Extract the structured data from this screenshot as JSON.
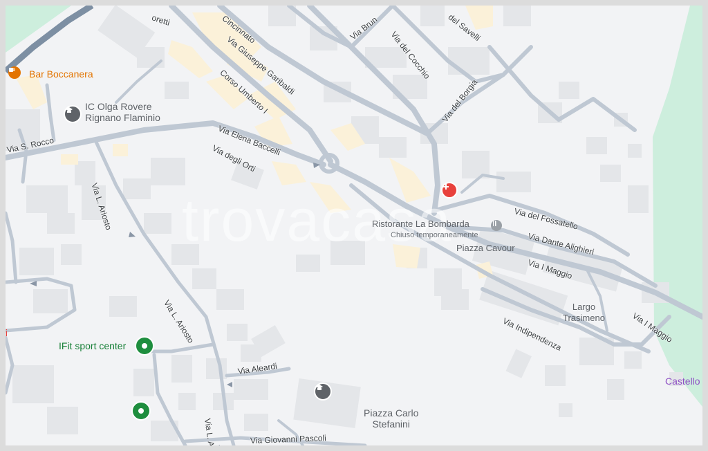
{
  "watermark": "trovacasa",
  "colors": {
    "background": "#f2f3f5",
    "road": "#bfc8d3",
    "building": "#e4e6e9",
    "highlight": "#fbf1d9",
    "park": "#cdeedd",
    "medical": "#e8413c",
    "green_pin": "#1e8e3e",
    "orange": "#e37400",
    "purple": "#8e4fc4"
  },
  "streets": {
    "ioretti": "oretti",
    "cincinnato": "Cincinnato",
    "giuseppe_garibaldi": "Via Giuseppe Garibaldi",
    "via_bruno": "Via Brun",
    "savelli": "del Savelli",
    "via_del_cocchio": "Via del Cocchio",
    "via_del_borgia": "Via del Borgia",
    "corso_umberto": "Corso Umberto I",
    "via_elena_baccelli": "Via Elena Baccelli",
    "via_degli_orti": "Via degli Orti",
    "via_s_rocco": "Via S. Rocco",
    "via_l_ariosto_1": "Via L. Ariosto",
    "via_l_ariosto_2": "Via L. Ariosto",
    "via_l_ario_3": "Via L. Ario",
    "via_del_fossatello": "Via del Fossatello",
    "via_dante_alighieri": "Via Dante Alighieri",
    "via_i_maggio_1": "Via I Maggio",
    "via_i_maggio_2": "Via I Maggio",
    "via_indipendenza": "Via Indipendenza",
    "via_aleardi": "Via Aleardi",
    "via_giovanni_pascoli": "Via Giovanni Pascoli"
  },
  "places": {
    "bar_boccanera": "Bar Boccanera",
    "ic_olga_rovere_1": "IC Olga Rovere",
    "ic_olga_rovere_2": "Rignano Flaminio",
    "ristorante": "Ristorante La Bombarda",
    "ristorante_status": "Chiuso temporaneamente",
    "piazza_cavour": "Piazza Cavour",
    "largo_trasimeno_1": "Largo",
    "largo_trasimeno_2": "Trasimeno",
    "ifit": "IFit sport center",
    "piazza_carlo_1": "Piazza Carlo",
    "piazza_carlo_2": "Stefanini",
    "castello": "Castello",
    "left_edge": "ti"
  }
}
